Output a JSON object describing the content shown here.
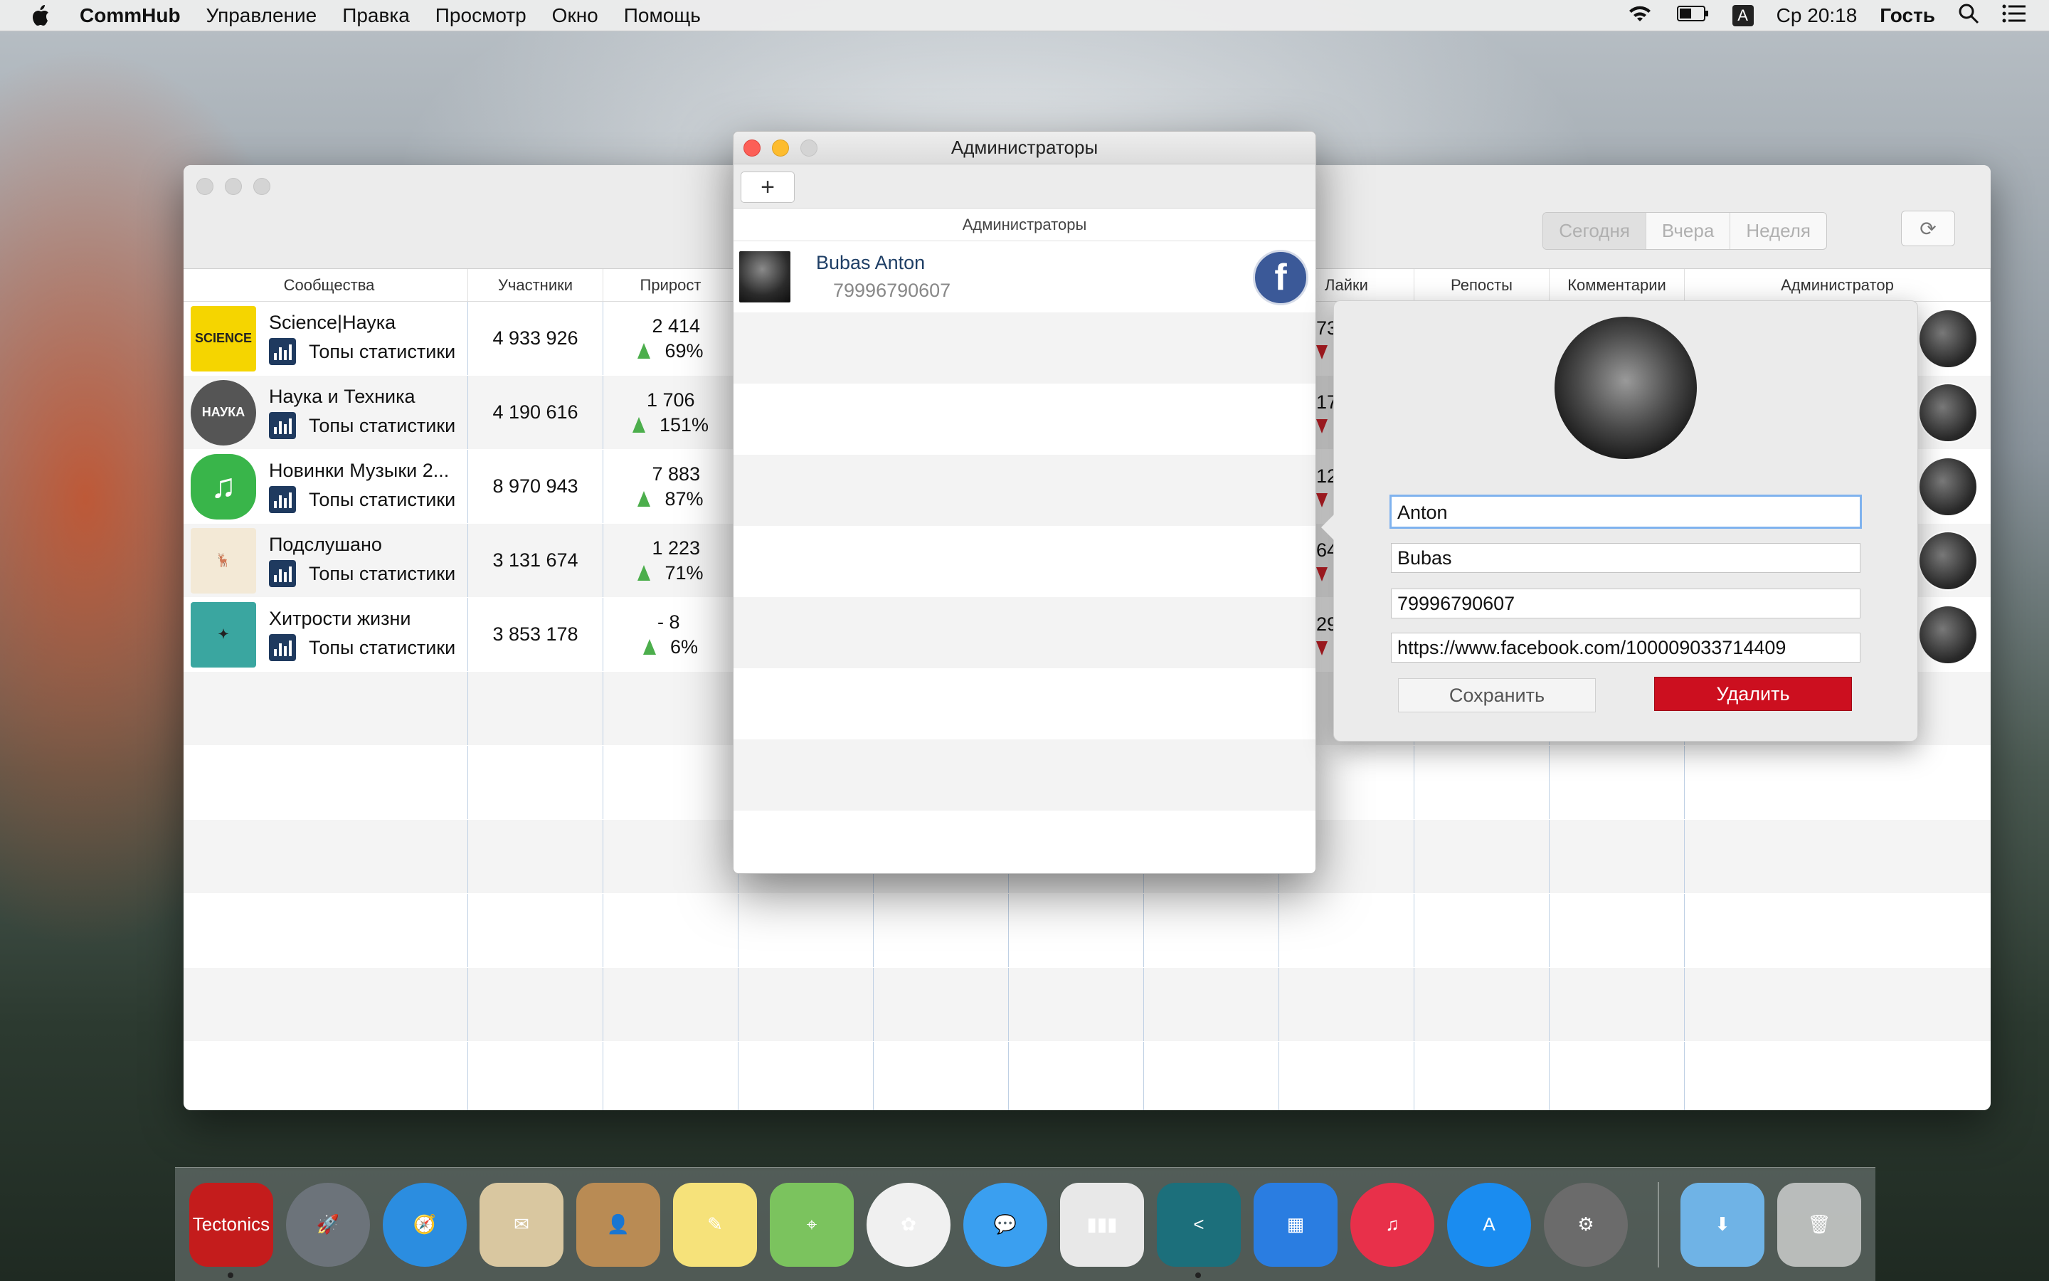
{
  "menubar": {
    "app_name": "CommHub",
    "items": [
      "Управление",
      "Правка",
      "Просмотр",
      "Окно",
      "Помощь"
    ],
    "input_source": "A",
    "clock": "Ср 20:18",
    "user": "Гость"
  },
  "main": {
    "segments": [
      "Сегодня",
      "Вчера",
      "Неделя"
    ],
    "columns": {
      "communities": "Сообщества",
      "members": "Участники",
      "growth": "Прирост",
      "likes": "Лайки",
      "reposts": "Репосты",
      "comments": "Комментарии",
      "admin": "Администратор"
    },
    "rows": [
      {
        "name": "Science|Наука",
        "sub": "Топы статистики",
        "members": "4  933 926",
        "growth": "2  414",
        "pct": "69%",
        "likes": "73",
        "img_color": "#f5d500",
        "img_text": "SCIENCE"
      },
      {
        "name": "Наука и Техника",
        "sub": "Топы статистики",
        "members": "4  190 616",
        "growth": "1  706",
        "pct": "151%",
        "likes": "17",
        "img_color": "#555555",
        "img_text": "НАУКА"
      },
      {
        "name": "Новинки Музыки 2...",
        "sub": "Топы статистики",
        "members": "8  970 943",
        "growth": "7  883",
        "pct": "87%",
        "likes": "12",
        "img_color": "#39b54a",
        "img_text": "♫"
      },
      {
        "name": "Подслушано",
        "sub": "Топы статистики",
        "members": "3  131 674",
        "growth": "1  223",
        "pct": "71%",
        "likes": "64",
        "img_color": "#f3e9d6",
        "img_text": "🦌"
      },
      {
        "name": "Хитрости жизни",
        "sub": "Топы статистики",
        "members": "3  853 178",
        "growth": "- 8",
        "pct": "6%",
        "likes": "29",
        "img_color": "#3aa6a0",
        "img_text": "✦"
      }
    ]
  },
  "dialog": {
    "title": "Администраторы",
    "add_label": "+",
    "header": "Администраторы",
    "admin": {
      "name": "Bubas Anton",
      "phone": "79996790607",
      "fb": "f"
    }
  },
  "editor": {
    "first_name": "Anton",
    "last_name": "Bubas",
    "phone": "79996790607",
    "url": "https://www.facebook.com/100009033714409",
    "save": "Сохранить",
    "delete": "Удалить"
  },
  "dock": {
    "apps": [
      {
        "name": "tectonics",
        "label": "Tectonics",
        "color": "#c41c1c",
        "running": true
      },
      {
        "name": "launchpad",
        "label": "🚀",
        "color": "#6c737a",
        "running": false
      },
      {
        "name": "safari",
        "label": "🧭",
        "color": "#2b8de0",
        "running": false
      },
      {
        "name": "mail",
        "label": "✉",
        "color": "#d9c7a0",
        "running": false
      },
      {
        "name": "contacts",
        "label": "👤",
        "color": "#b98b54",
        "running": false
      },
      {
        "name": "notes",
        "label": "✎",
        "color": "#f6e27a",
        "running": false
      },
      {
        "name": "maps",
        "label": "⌖",
        "color": "#7bc35e",
        "running": false
      },
      {
        "name": "photos",
        "label": "✿",
        "color": "#f0f0f0",
        "running": false
      },
      {
        "name": "messages",
        "label": "💬",
        "color": "#3a9ff0",
        "running": false
      },
      {
        "name": "numbers",
        "label": "▮▮▮",
        "color": "#e8e8e8",
        "running": false
      },
      {
        "name": "commhub",
        "label": "<",
        "color": "#1c6f7b",
        "running": true
      },
      {
        "name": "keynote",
        "label": "▦",
        "color": "#2a7de1",
        "running": false
      },
      {
        "name": "itunes",
        "label": "♫",
        "color": "#e8304a",
        "running": false
      },
      {
        "name": "appstore",
        "label": "A",
        "color": "#1a8cf0",
        "running": false
      },
      {
        "name": "system-preferences",
        "label": "⚙",
        "color": "#6b6b6b",
        "running": false
      }
    ],
    "downloads": "⬇",
    "trash": "🗑"
  }
}
